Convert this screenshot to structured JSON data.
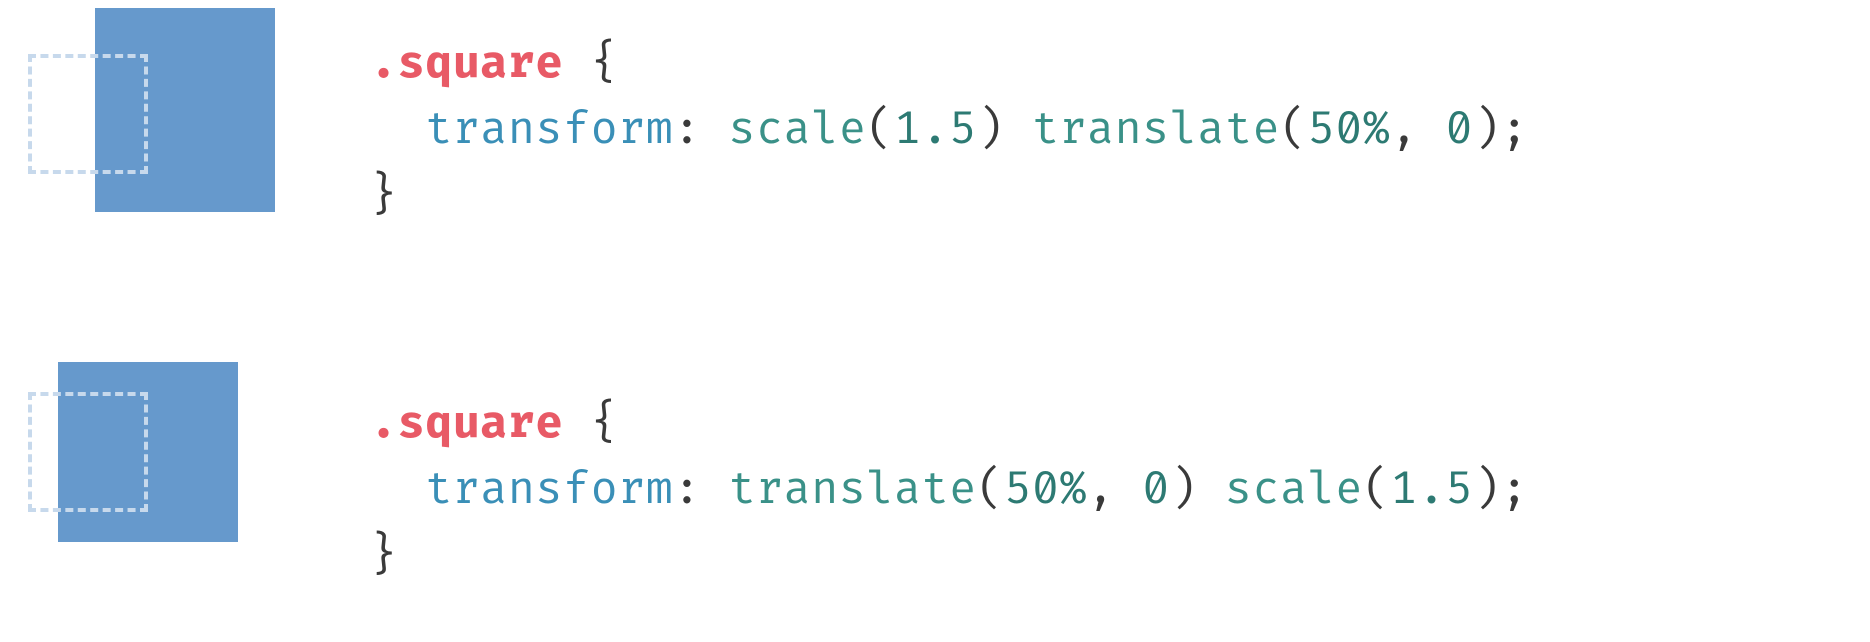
{
  "example1": {
    "selector": ".square",
    "open_brace": " {",
    "indent": "  ",
    "property": "transform",
    "colon": ": ",
    "func1": "scale",
    "open1": "(",
    "arg1": "1.5",
    "close1": ") ",
    "func2": "translate",
    "open2": "(",
    "arg2a": "50%",
    "comma": ", ",
    "arg2b": "0",
    "close2": ");",
    "close_brace": "}"
  },
  "example2": {
    "selector": ".square",
    "open_brace": " {",
    "indent": "  ",
    "property": "transform",
    "colon": ": ",
    "func1": "translate",
    "open1": "(",
    "arg1a": "50%",
    "comma": ", ",
    "arg1b": "0",
    "close1": ") ",
    "func2": "scale",
    "open2": "(",
    "arg2": "1.5",
    "close2": ");",
    "close_brace": "}"
  }
}
